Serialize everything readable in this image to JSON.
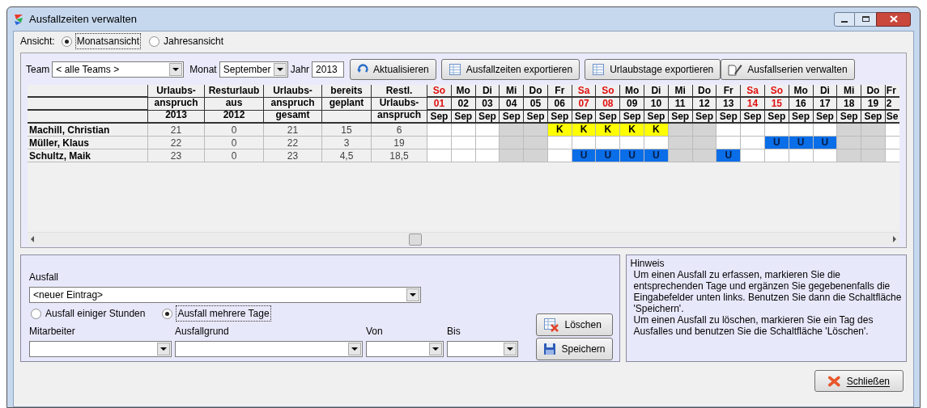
{
  "window": {
    "title": "Ausfallzeiten verwalten"
  },
  "view": {
    "label": "Ansicht:",
    "options": [
      {
        "label": "Monatsansicht",
        "selected": true
      },
      {
        "label": "Jahresansicht",
        "selected": false
      }
    ]
  },
  "toolbar": {
    "team_label": "Team",
    "team": "< alle Teams >",
    "month_label": "Monat",
    "month": "September",
    "year_label": "Jahr",
    "year": "2013",
    "buttons": [
      {
        "label": "Aktualisieren",
        "kind": "refresh"
      },
      {
        "label": "Ausfallzeiten exportieren",
        "kind": "table"
      },
      {
        "label": "Urlaubstage exportieren",
        "kind": "table"
      },
      {
        "label": "Ausfallserien verwalten",
        "kind": "edit"
      }
    ]
  },
  "table": {
    "columns": [
      "Urlaubs-\nanspruch\n2013",
      "Resturlaub\naus\n2012",
      "Urlaubs-\nanspruch\ngesamt",
      "bereits\ngeplant",
      "Restl.\nUrlaubs-\nanspruch"
    ],
    "days": [
      {
        "dow": "So",
        "day": "01",
        "month": "Sep",
        "weekend": true
      },
      {
        "dow": "Mo",
        "day": "02",
        "month": "Sep",
        "weekend": false
      },
      {
        "dow": "Di",
        "day": "03",
        "month": "Sep",
        "weekend": false
      },
      {
        "dow": "Mi",
        "day": "04",
        "month": "Sep",
        "weekend": false
      },
      {
        "dow": "Do",
        "day": "05",
        "month": "Sep",
        "weekend": false
      },
      {
        "dow": "Fr",
        "day": "06",
        "month": "Sep",
        "weekend": false
      },
      {
        "dow": "Sa",
        "day": "07",
        "month": "Sep",
        "weekend": true
      },
      {
        "dow": "So",
        "day": "08",
        "month": "Sep",
        "weekend": true
      },
      {
        "dow": "Mo",
        "day": "09",
        "month": "Sep",
        "weekend": false
      },
      {
        "dow": "Di",
        "day": "10",
        "month": "Sep",
        "weekend": false
      },
      {
        "dow": "Mi",
        "day": "11",
        "month": "Sep",
        "weekend": false
      },
      {
        "dow": "Do",
        "day": "12",
        "month": "Sep",
        "weekend": false
      },
      {
        "dow": "Fr",
        "day": "13",
        "month": "Sep",
        "weekend": false
      },
      {
        "dow": "Sa",
        "day": "14",
        "month": "Sep",
        "weekend": true
      },
      {
        "dow": "So",
        "day": "15",
        "month": "Sep",
        "weekend": true
      },
      {
        "dow": "Mo",
        "day": "16",
        "month": "Sep",
        "weekend": false
      },
      {
        "dow": "Di",
        "day": "17",
        "month": "Sep",
        "weekend": false
      },
      {
        "dow": "Mi",
        "day": "18",
        "month": "Sep",
        "weekend": false
      },
      {
        "dow": "Do",
        "day": "19",
        "month": "Sep",
        "weekend": false
      },
      {
        "dow": "Fr",
        "day": "2",
        "month": "Se",
        "weekend": false
      }
    ],
    "rows": [
      {
        "name": "Machill, Christian",
        "values": [
          "21",
          "0",
          "21",
          "15",
          "6"
        ],
        "cells": [
          {
            "kind": "free"
          },
          {
            "kind": "free"
          },
          {
            "kind": "free"
          },
          {
            "kind": "blocked"
          },
          {
            "kind": "blocked"
          },
          {
            "kind": "sick",
            "text": "K"
          },
          {
            "kind": "sick",
            "text": "K"
          },
          {
            "kind": "sick",
            "text": "K"
          },
          {
            "kind": "sick",
            "text": "K"
          },
          {
            "kind": "sick",
            "text": "K"
          },
          {
            "kind": "blocked"
          },
          {
            "kind": "blocked"
          },
          {
            "kind": "free"
          },
          {
            "kind": "free"
          },
          {
            "kind": "free"
          },
          {
            "kind": "free"
          },
          {
            "kind": "free"
          },
          {
            "kind": "blocked"
          },
          {
            "kind": "blocked"
          },
          {
            "kind": "free"
          }
        ]
      },
      {
        "name": "Müller, Klaus",
        "values": [
          "22",
          "0",
          "22",
          "3",
          "19"
        ],
        "cells": [
          {
            "kind": "free"
          },
          {
            "kind": "free"
          },
          {
            "kind": "free"
          },
          {
            "kind": "blocked"
          },
          {
            "kind": "blocked"
          },
          {
            "kind": "free"
          },
          {
            "kind": "free"
          },
          {
            "kind": "free"
          },
          {
            "kind": "free"
          },
          {
            "kind": "free"
          },
          {
            "kind": "blocked"
          },
          {
            "kind": "blocked"
          },
          {
            "kind": "free"
          },
          {
            "kind": "free"
          },
          {
            "kind": "vacation",
            "text": "U"
          },
          {
            "kind": "vacation",
            "text": "U"
          },
          {
            "kind": "vacation",
            "text": "U"
          },
          {
            "kind": "blocked"
          },
          {
            "kind": "blocked"
          },
          {
            "kind": "free"
          }
        ]
      },
      {
        "name": "Schultz, Maik",
        "values": [
          "23",
          "0",
          "23",
          "4,5",
          "18,5"
        ],
        "cells": [
          {
            "kind": "free"
          },
          {
            "kind": "free"
          },
          {
            "kind": "free"
          },
          {
            "kind": "blocked"
          },
          {
            "kind": "blocked"
          },
          {
            "kind": "free"
          },
          {
            "kind": "vacation",
            "text": "U"
          },
          {
            "kind": "vacation",
            "text": "U"
          },
          {
            "kind": "vacation",
            "text": "U"
          },
          {
            "kind": "vacation",
            "text": "U"
          },
          {
            "kind": "blocked"
          },
          {
            "kind": "blocked"
          },
          {
            "kind": "vacation",
            "text": "U"
          },
          {
            "kind": "free"
          },
          {
            "kind": "free"
          },
          {
            "kind": "free"
          },
          {
            "kind": "free"
          },
          {
            "kind": "blocked"
          },
          {
            "kind": "blocked"
          },
          {
            "kind": "free"
          }
        ]
      }
    ]
  },
  "form": {
    "absence_label": "Ausfall",
    "absence": "<neuer Eintrag>",
    "modes": [
      {
        "label": "Ausfall einiger Stunden",
        "selected": false
      },
      {
        "label": "Ausfall mehrere Tage",
        "selected": true
      }
    ],
    "fields": [
      {
        "label": "Mitarbeiter"
      },
      {
        "label": "Ausfallgrund"
      },
      {
        "label": "Von"
      },
      {
        "label": "Bis"
      }
    ],
    "buttons": [
      {
        "label": "Löschen",
        "kind": "delete"
      },
      {
        "label": "Speichern",
        "kind": "save"
      }
    ]
  },
  "hint": {
    "title": "Hinweis",
    "text": "Um einen Ausfall zu erfassen, markieren Sie die entsprechenden Tage und ergänzen Sie gegebenenfalls die Eingabefelder unten links. Benutzen Sie dann die Schaltfläche 'Speichern'.\nUm einen Ausfall zu löschen, markieren Sie ein Tag des Ausfalles und benutzen Sie die Schaltfläche 'Löschen'."
  },
  "close_button": {
    "label": "Schließen"
  }
}
